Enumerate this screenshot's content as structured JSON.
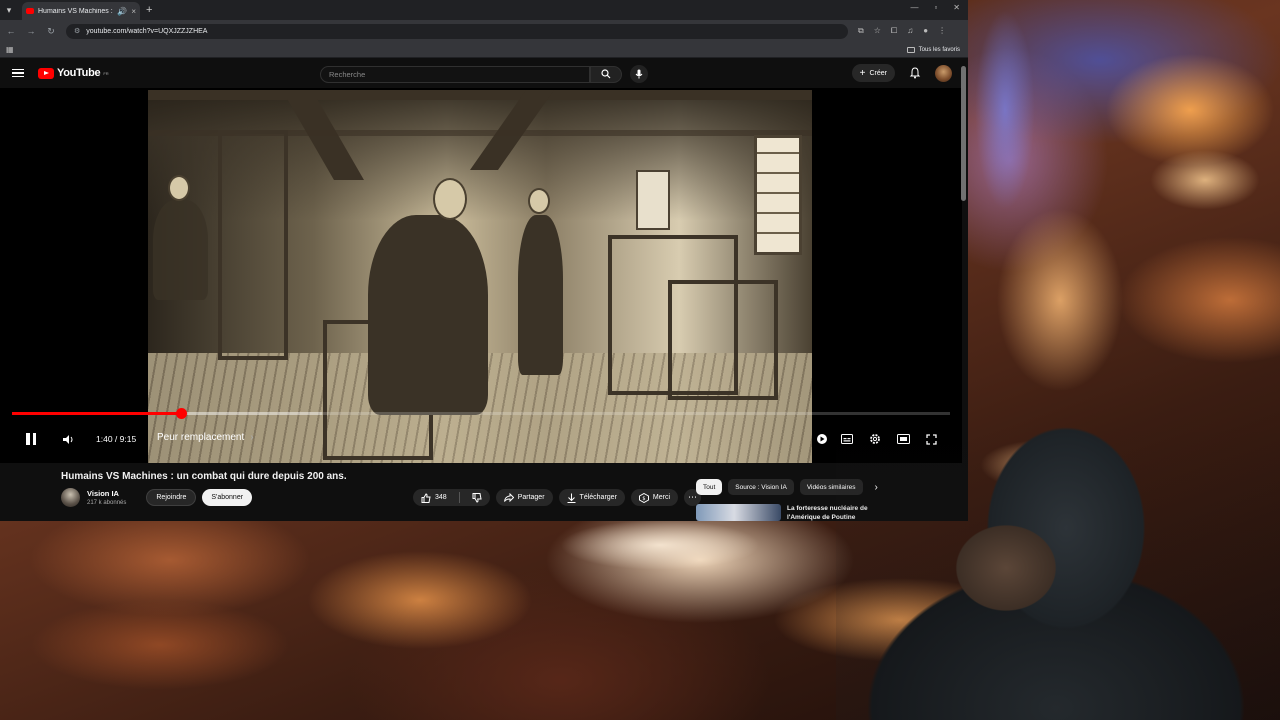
{
  "browser": {
    "tab_title": "Humains VS Machines : un",
    "url": "youtube.com/watch?v=UQXJZZJZHEA",
    "bookmarks_folder": "Tous les favoris"
  },
  "youtube": {
    "logo_text": "YouTube",
    "logo_region": "FR",
    "search_placeholder": "Recherche",
    "create_label": "Créer"
  },
  "player": {
    "time": "1:40 / 9:15",
    "progress_fraction": 0.18,
    "chapter": "Peur remplacement",
    "chapter_chevron": "›"
  },
  "video": {
    "title": "Humains VS Machines : un combat qui dure depuis 200 ans.",
    "channel_name": "Vision IA",
    "subscribers": "217 k abonnés",
    "join_label": "Rejoindre",
    "subscribe_label": "S'abonner",
    "like_count": "348",
    "share_label": "Partager",
    "download_label": "Télécharger",
    "thanks_label": "Merci",
    "more_label": "⋯"
  },
  "chips": [
    "Tout",
    "Source : Vision IA",
    "Vidéos similaires"
  ],
  "recommendation": {
    "title_line1": "La forteresse nucléaire de",
    "title_line2": "l'Amérique de Poutine"
  },
  "icons": {
    "pause": "pause-icon",
    "volume": "volume-icon",
    "autoplay": "autoplay-icon",
    "subtitles": "subtitles-icon",
    "settings": "settings-icon",
    "theater": "theater-icon",
    "fullscreen": "fullscreen-icon"
  },
  "colors": {
    "accent": "#ff0000",
    "page_bg": "#0f0f0f",
    "chrome_bg": "#35363a"
  }
}
